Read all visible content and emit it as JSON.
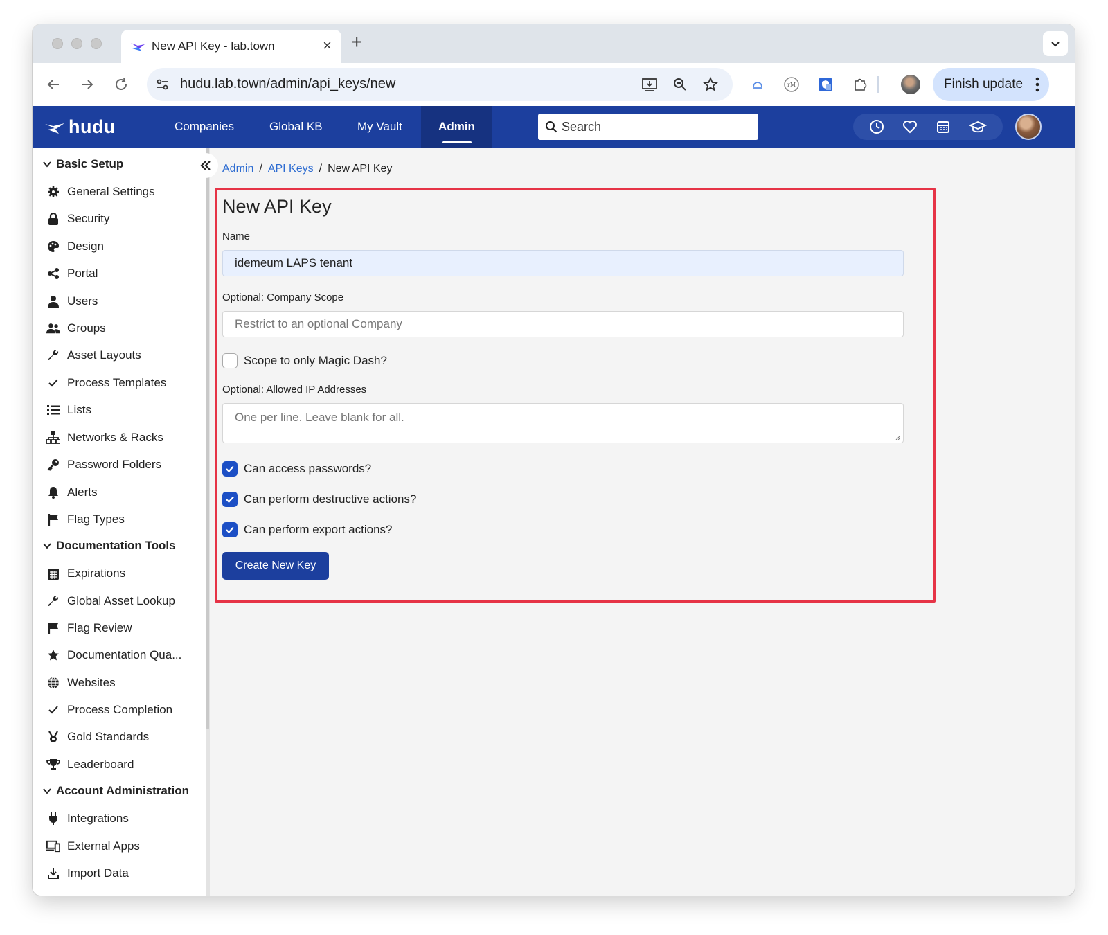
{
  "browser": {
    "tab_title": "New API Key - lab.town",
    "url": "hudu.lab.town/admin/api_keys/new",
    "finish_update_label": "Finish update"
  },
  "app": {
    "brand": "hudu",
    "nav": [
      {
        "label": "Companies"
      },
      {
        "label": "Global KB"
      },
      {
        "label": "My Vault"
      },
      {
        "label": "Admin",
        "active": true
      }
    ],
    "search_placeholder": "Search",
    "accent_color": "#1c3f9e"
  },
  "sidebar": {
    "sections": [
      {
        "title": "Basic Setup",
        "items": [
          {
            "label": "General Settings",
            "icon": "gear-icon"
          },
          {
            "label": "Security",
            "icon": "lock-icon"
          },
          {
            "label": "Design",
            "icon": "palette-icon"
          },
          {
            "label": "Portal",
            "icon": "share-icon"
          },
          {
            "label": "Users",
            "icon": "user-icon"
          },
          {
            "label": "Groups",
            "icon": "users-icon"
          },
          {
            "label": "Asset Layouts",
            "icon": "wrench-icon"
          },
          {
            "label": "Process Templates",
            "icon": "check-icon"
          },
          {
            "label": "Lists",
            "icon": "list-icon"
          },
          {
            "label": "Networks & Racks",
            "icon": "network-icon"
          },
          {
            "label": "Password Folders",
            "icon": "key-icon"
          },
          {
            "label": "Alerts",
            "icon": "bell-icon"
          },
          {
            "label": "Flag Types",
            "icon": "flag-icon"
          }
        ]
      },
      {
        "title": "Documentation Tools",
        "items": [
          {
            "label": "Expirations",
            "icon": "calendar-icon"
          },
          {
            "label": "Global Asset Lookup",
            "icon": "wrench-icon"
          },
          {
            "label": "Flag Review",
            "icon": "flag-icon"
          },
          {
            "label": "Documentation Qua...",
            "icon": "star-icon"
          },
          {
            "label": "Websites",
            "icon": "globe-icon"
          },
          {
            "label": "Process Completion",
            "icon": "check-icon"
          },
          {
            "label": "Gold Standards",
            "icon": "medal-icon"
          },
          {
            "label": "Leaderboard",
            "icon": "trophy-icon"
          }
        ]
      },
      {
        "title": "Account Administration",
        "items": [
          {
            "label": "Integrations",
            "icon": "plug-icon"
          },
          {
            "label": "External Apps",
            "icon": "devices-icon"
          },
          {
            "label": "Import Data",
            "icon": "import-icon"
          }
        ]
      }
    ]
  },
  "breadcrumb": {
    "items": [
      "Admin",
      "API Keys",
      "New API Key"
    ],
    "separator": "/"
  },
  "form": {
    "title": "New API Key",
    "name_label": "Name",
    "name_value": "idemeum LAPS tenant",
    "company_scope_label": "Optional: Company Scope",
    "company_scope_placeholder": "Restrict to an optional Company",
    "magic_dash_label": "Scope to only Magic Dash?",
    "magic_dash_checked": false,
    "ip_label": "Optional: Allowed IP Addresses",
    "ip_placeholder": "One per line. Leave blank for all.",
    "permissions": [
      {
        "label": "Can access passwords?",
        "checked": true
      },
      {
        "label": "Can perform destructive actions?",
        "checked": true
      },
      {
        "label": "Can perform export actions?",
        "checked": true
      }
    ],
    "submit_label": "Create New Key",
    "highlight_color": "#e63346"
  }
}
